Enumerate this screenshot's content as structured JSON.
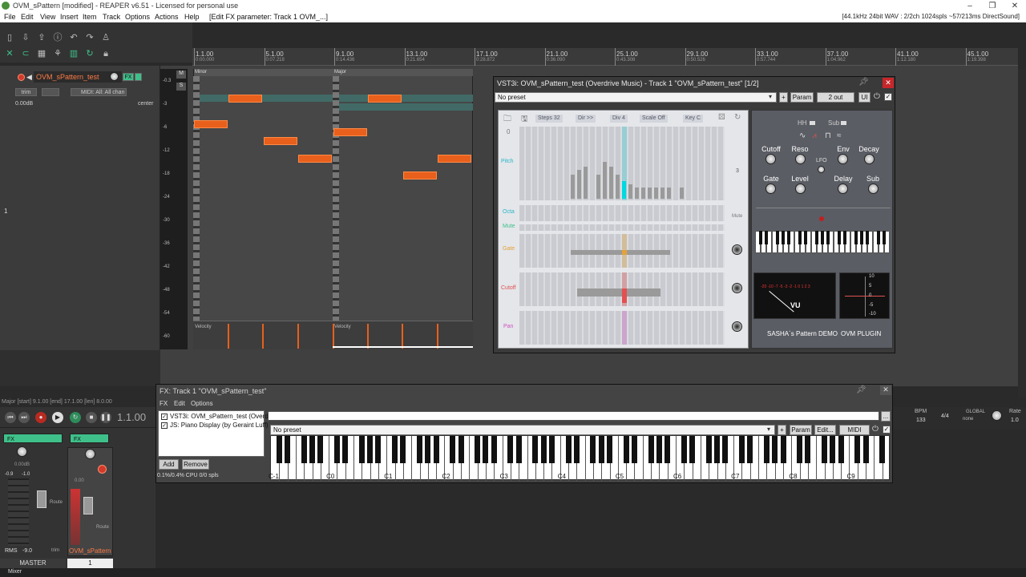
{
  "window": {
    "title": "OVM_sPattern [modified] - REAPER v6.51 - Licensed for personal use",
    "controls": [
      "–",
      "❐",
      "✕"
    ]
  },
  "menu": {
    "items": [
      "File",
      "Edit",
      "View",
      "Insert",
      "Item",
      "Track",
      "Options",
      "Actions",
      "Help"
    ],
    "context": "[Edit FX parameter: Track 1 OVM_...]",
    "status": "[44.1kHz 24bit WAV : 2/2ch 1024spls ~57/213ms DirectSound]"
  },
  "ruler": {
    "marks": [
      {
        "label": "1.1.00",
        "sub": "0:00.000"
      },
      {
        "label": "5.1.00",
        "sub": "0:07.218"
      },
      {
        "label": "9.1.00",
        "sub": "0:14.436"
      },
      {
        "label": "13.1.00",
        "sub": "0:21.654"
      },
      {
        "label": "17.1.00",
        "sub": "0:28.872"
      },
      {
        "label": "21.1.00",
        "sub": "0:36.090"
      },
      {
        "label": "25.1.00",
        "sub": "0:43.308"
      },
      {
        "label": "29.1.00",
        "sub": "0:50.526"
      },
      {
        "label": "33.1.00",
        "sub": "0:57.744"
      },
      {
        "label": "37.1.00",
        "sub": "1:04.962"
      },
      {
        "label": "41.1.00",
        "sub": "1:12.180"
      },
      {
        "label": "45.1.00",
        "sub": "1:19.398"
      }
    ]
  },
  "track": {
    "number": "1",
    "name": "OVM_sPattern_test",
    "fx_label": "FX",
    "trim_label": "trim",
    "midi_input": "MIDI: All: All chan",
    "volume": "0.00dB",
    "pan": "center",
    "db_scale": [
      "-0.3",
      "-3",
      "-6",
      "-12",
      "-18",
      "-24",
      "-30",
      "-36",
      "-42",
      "-48",
      "-54",
      "-60"
    ]
  },
  "midi_item": {
    "chord_labels": [
      "Minor",
      "Major"
    ],
    "velocity_label": "Velocity"
  },
  "plugin": {
    "title": "VST3i: OVM_sPattern_test (Overdrive Music) - Track 1 \"OVM_sPattern_test\" [1/2]",
    "preset": "No preset",
    "plus_label": "+",
    "param_label": "Param",
    "out_label": "2 out",
    "ui_label": "UI",
    "seq": {
      "steps": "Steps 32",
      "dir": "Dir >>",
      "div": "Div 4",
      "scale": "Scale Off",
      "key": "Key C",
      "row_labels": [
        "Pitch",
        "Octa",
        "Mute",
        "Gate",
        "Cutoff",
        "Pan"
      ],
      "zero_label": "0",
      "mute_label": "Mute",
      "oct_value": "3"
    },
    "synth": {
      "hh_label": "HH",
      "sub_label": "Sub",
      "knobs_row1": [
        "Cutoff",
        "Reso",
        "Env",
        "Decay"
      ],
      "lfo_label": "LFO",
      "knobs_row2": [
        "Gate",
        "Level",
        "Delay",
        "Sub"
      ],
      "vu_label": "VU",
      "vu_scale": "-20 -10 -7 -5 -3 -2 -1 0 1 2 3",
      "meter_scale": [
        "10",
        "5",
        "0",
        "-5",
        "-10"
      ],
      "footer_left": "SASHA`s Pattern DEMO",
      "footer_right": "OVM PLUGIN"
    }
  },
  "fxchain": {
    "title": "FX: Track 1 \"OVM_sPattern_test\"",
    "menu": [
      "FX",
      "Edit",
      "Options"
    ],
    "items": [
      {
        "name": "VST3i: OVM_sPattern_test (Overd...",
        "enabled": true
      },
      {
        "name": "JS: Piano Display (by Geraint Luff)",
        "enabled": true
      }
    ],
    "add_label": "Add",
    "remove_label": "Remove",
    "cpu": "0.1%/0.4% CPU 0/0 spls",
    "preset": "No preset",
    "edit_label": "Edit...",
    "midi_label": "MIDI",
    "param_label": "Param",
    "plus_label": "+",
    "dots_label": "...",
    "octave_labels": [
      "C-1",
      "C0",
      "C1",
      "C2",
      "C3",
      "C4",
      "C5",
      "C6",
      "C7",
      "C8",
      "C9"
    ]
  },
  "transport": {
    "time": "1.1.00",
    "selection": "Major [start] 9.1.00 [end] 17.1.00 [len] 8.0.00",
    "bpm_label": "BPM",
    "bpm": "133",
    "sig": "4/4",
    "global_label": "GLOBAL",
    "global_mode": "none",
    "rate_label": "Rate",
    "rate": "1.0"
  },
  "mixer": {
    "master_label": "MASTER",
    "track_number": "1",
    "track_name": "OVM_sPattern",
    "master_db": "0.00dB",
    "master_peaks": [
      "-0.9",
      "-1.0"
    ],
    "track_db": "0.00",
    "rms": "RMS",
    "rms_value": "-9.0",
    "fx_label": "FX",
    "route_label": "Route",
    "trim_label": "trim",
    "mixer_tab": "Mixer"
  },
  "colors": {
    "note": "#e8601c",
    "accent_green": "#3fc08a",
    "rec_red": "#d23a2a",
    "pitch_cyan": "#00d8e0"
  }
}
